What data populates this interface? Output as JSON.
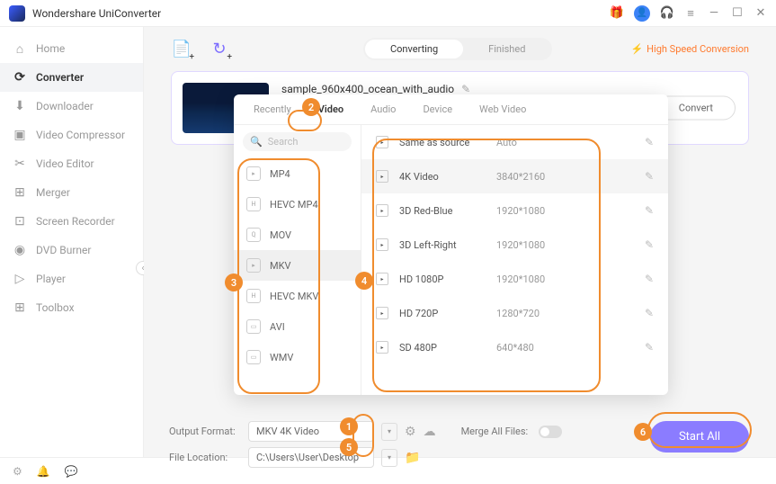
{
  "app": {
    "title": "Wondershare UniConverter"
  },
  "sidebar": {
    "items": [
      {
        "label": "Home",
        "icon": "⌂"
      },
      {
        "label": "Converter",
        "icon": "⟳"
      },
      {
        "label": "Downloader",
        "icon": "⬇"
      },
      {
        "label": "Video Compressor",
        "icon": "▣"
      },
      {
        "label": "Video Editor",
        "icon": "✂"
      },
      {
        "label": "Merger",
        "icon": "⊞"
      },
      {
        "label": "Screen Recorder",
        "icon": "⊡"
      },
      {
        "label": "DVD Burner",
        "icon": "◉"
      },
      {
        "label": "Player",
        "icon": "▷"
      },
      {
        "label": "Toolbox",
        "icon": "⊞"
      }
    ]
  },
  "topbar": {
    "tabs": {
      "converting": "Converting",
      "finished": "Finished"
    },
    "hsc": "High Speed Conversion"
  },
  "file": {
    "name": "sample_960x400_ocean_with_audio",
    "convert_label": "Convert"
  },
  "popup": {
    "tabs": [
      "Recently",
      "Video",
      "Audio",
      "Device",
      "Web Video"
    ],
    "search_placeholder": "Search",
    "formats": [
      "MP4",
      "HEVC MP4",
      "MOV",
      "MKV",
      "HEVC MKV",
      "AVI",
      "WMV"
    ],
    "resolutions": [
      {
        "name": "Same as source",
        "dim": "Auto"
      },
      {
        "name": "4K Video",
        "dim": "3840*2160"
      },
      {
        "name": "3D Red-Blue",
        "dim": "1920*1080"
      },
      {
        "name": "3D Left-Right",
        "dim": "1920*1080"
      },
      {
        "name": "HD 1080P",
        "dim": "1920*1080"
      },
      {
        "name": "HD 720P",
        "dim": "1280*720"
      },
      {
        "name": "SD 480P",
        "dim": "640*480"
      }
    ]
  },
  "footer": {
    "output_format_label": "Output Format:",
    "output_format_value": "MKV 4K Video",
    "file_location_label": "File Location:",
    "file_location_value": "C:\\Users\\User\\Desktop",
    "merge_label": "Merge All Files:",
    "start_label": "Start All"
  },
  "callouts": {
    "1": "1",
    "2": "2",
    "3": "3",
    "4": "4",
    "5": "5",
    "6": "6"
  }
}
